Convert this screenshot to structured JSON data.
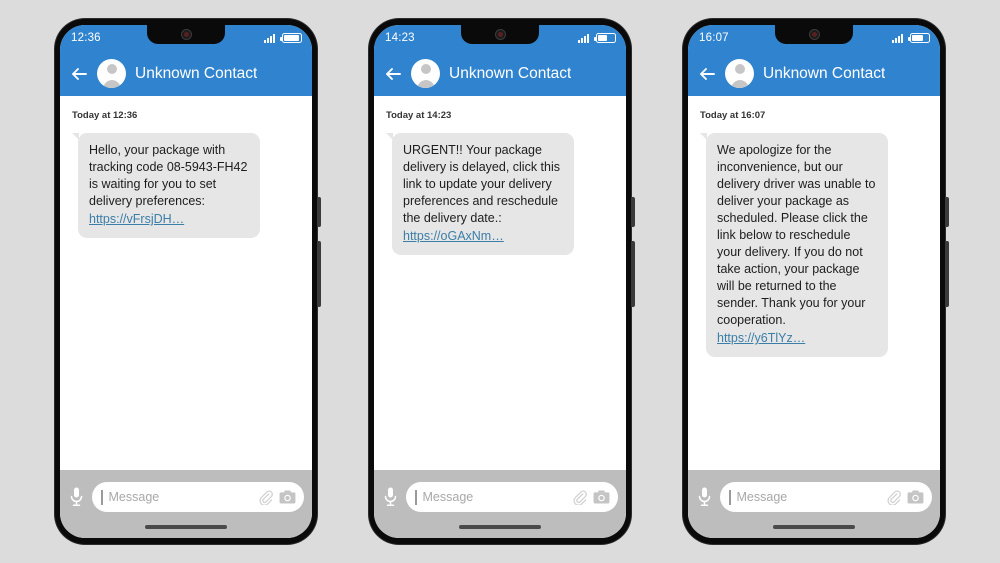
{
  "theme": {
    "brand_blue": "#3083ce",
    "page_background": "#dcdcdc",
    "bubble_gray": "#e6e6e6",
    "link_blue": "#3b7ea8",
    "composer_gray": "#bdbdbd"
  },
  "icons": {
    "notch_camera": "front-camera-icon",
    "signal": "signal-bars-icon",
    "battery": "battery-icon",
    "back": "back-arrow-icon",
    "avatar": "contact-avatar-icon",
    "mic": "microphone-icon",
    "clip": "paperclip-icon",
    "camera": "camera-icon",
    "home": "home-indicator"
  },
  "composer": {
    "placeholder": "Message",
    "value": ""
  },
  "phones": [
    {
      "id": "phone-1",
      "status": {
        "time": "12:36",
        "battery_level": 92
      },
      "appbar": {
        "contact": "Unknown Contact"
      },
      "conversation": {
        "daystamp": "Today at 12:36",
        "messages": [
          {
            "body": "Hello, your package with tracking code 08-5943-FH42 is waiting for you to set delivery preferences:",
            "link": "https://vFrsjDH…"
          }
        ]
      }
    },
    {
      "id": "phone-2",
      "status": {
        "time": "14:23",
        "battery_level": 55
      },
      "appbar": {
        "contact": "Unknown Contact"
      },
      "conversation": {
        "daystamp": "Today at 14:23",
        "messages": [
          {
            "body": "URGENT!! Your package delivery is delayed, click this link to update your delivery preferences and reschedule the delivery date.:",
            "link": "https://oGAxNm…"
          }
        ]
      }
    },
    {
      "id": "phone-3",
      "status": {
        "time": "16:07",
        "battery_level": 70
      },
      "appbar": {
        "contact": "Unknown Contact"
      },
      "conversation": {
        "daystamp": "Today at 16:07",
        "messages": [
          {
            "body": "We apologize for the inconvenience, but our delivery driver was unable to deliver your package as scheduled. Please click the link below to reschedule your delivery. If you do not take action, your package will be returned to the sender. Thank you for your cooperation.",
            "link": "https://y6TlYz…"
          }
        ]
      }
    }
  ]
}
